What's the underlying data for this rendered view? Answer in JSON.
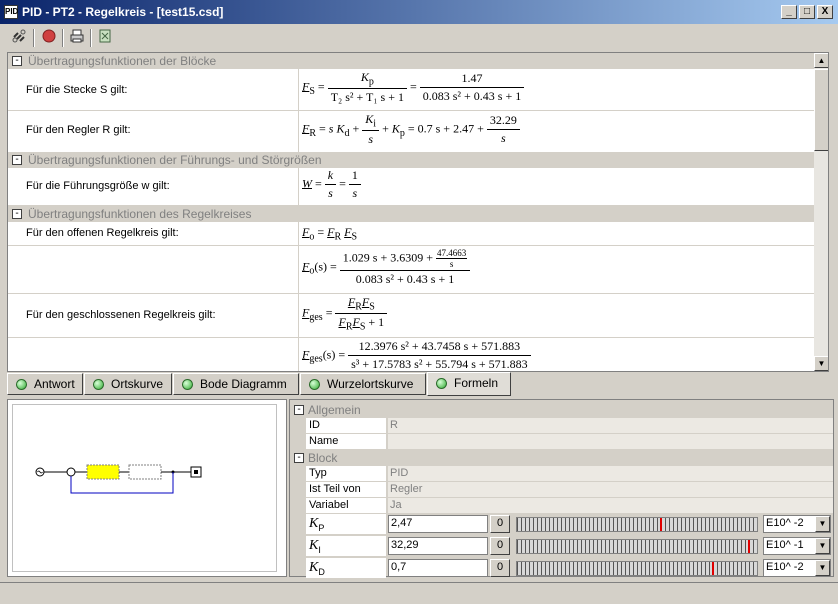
{
  "window": {
    "title": "PID - PT2 - Regelkreis - [test15.csd]",
    "icon_text": "PID"
  },
  "window_buttons": [
    "_",
    "□",
    "X"
  ],
  "toolbar": {
    "icons": [
      "link-icon",
      "stop-icon",
      "print-icon",
      "calc-icon"
    ]
  },
  "formula_sections": [
    {
      "title": "Übertragungsfunktionen der Blöcke"
    },
    {
      "title": "Übertragungsfunktionen der Führungs- und Störgrößen"
    },
    {
      "title": "Übertragungsfunktionen des Regelkreises"
    }
  ],
  "formula_rows": {
    "strecke_label": "Für die Stecke S gilt:",
    "regler_label": "Für den Regler R gilt:",
    "fuehrung_label": "Für die Führungsgröße w gilt:",
    "offen_label": "Für den offenen Regelkreis gilt:",
    "geschlossen_label": "Für den geschlossenen Regelkreis gilt:"
  },
  "formulas": {
    "fs_lhs": "F",
    "fs_lhs_sub": "S",
    "fs_num": "K",
    "fs_num_sub": "p",
    "fs_den": "T₂ s² + T₁ s + 1",
    "fs_num2": "1.47",
    "fs_den2": "0.083 s² + 0.43 s + 1",
    "fr_lhs_sub": "R",
    "fr_a": "s K",
    "fr_a_sub": "d",
    "fr_num": "K",
    "fr_num_sub": "i",
    "fr_den": "s",
    "fr_b": "K",
    "fr_b_sub": "p",
    "fr_c": "= 0.7 s + 2.47 +",
    "fr_num2": "32.29",
    "fr_den2": "s",
    "w_lhs": "W",
    "w_num": "k",
    "w_den": "s",
    "w_num2": "1",
    "w_den2": "s",
    "fo_lhs_sub": "o",
    "fo_rhs": "F",
    "fo_rhs_sub1": "R",
    "fo_rhs_sub2": "S",
    "fos_lhs": "(s) =",
    "fos_num_a": "1.029 s + 3.6309 +",
    "fos_num_small_n": "47.4663",
    "fos_num_small_d": "s",
    "fos_den": "0.083 s² + 0.43 s + 1",
    "fg_lhs_sub": "ges",
    "fg_num": "F",
    "fg_den_b": "+ 1",
    "fgs_num": "12.3976 s² + 43.7458 s + 571.883",
    "fgs_den": "s³ + 17.5783 s² + 55.794 s + 571.883"
  },
  "tabs": [
    {
      "label": "Antwort",
      "active": false
    },
    {
      "label": "Ortskurve",
      "active": false
    },
    {
      "label": "Bode Diagramm",
      "active": false
    },
    {
      "label": "Wurzelortskurve",
      "active": false
    },
    {
      "label": "Formeln",
      "active": true
    }
  ],
  "properties": {
    "allgemein_title": "Allgemein",
    "block_title": "Block",
    "id_label": "ID",
    "id_value": "R",
    "name_label": "Name",
    "name_value": "",
    "typ_label": "Typ",
    "typ_value": "PID",
    "teil_label": "Ist Teil von",
    "teil_value": "Regler",
    "variabel_label": "Variabel",
    "variabel_value": "Ja"
  },
  "gains": [
    {
      "symbol": "K",
      "sub": "P",
      "value": "2,47",
      "zero": "0",
      "exponent": "E10^ -2",
      "slider_level": 0.6
    },
    {
      "symbol": "K",
      "sub": "I",
      "value": "32,29",
      "zero": "0",
      "exponent": "E10^ -1",
      "slider_level": 0.97
    },
    {
      "symbol": "K",
      "sub": "D",
      "value": "0,7",
      "zero": "0",
      "exponent": "E10^ -2",
      "slider_level": 0.82
    }
  ],
  "colors": {
    "title_start": "#0a246a",
    "title_end": "#a6caf0",
    "controller_block": "#ffff00",
    "feedback_line": "#0000c0"
  }
}
